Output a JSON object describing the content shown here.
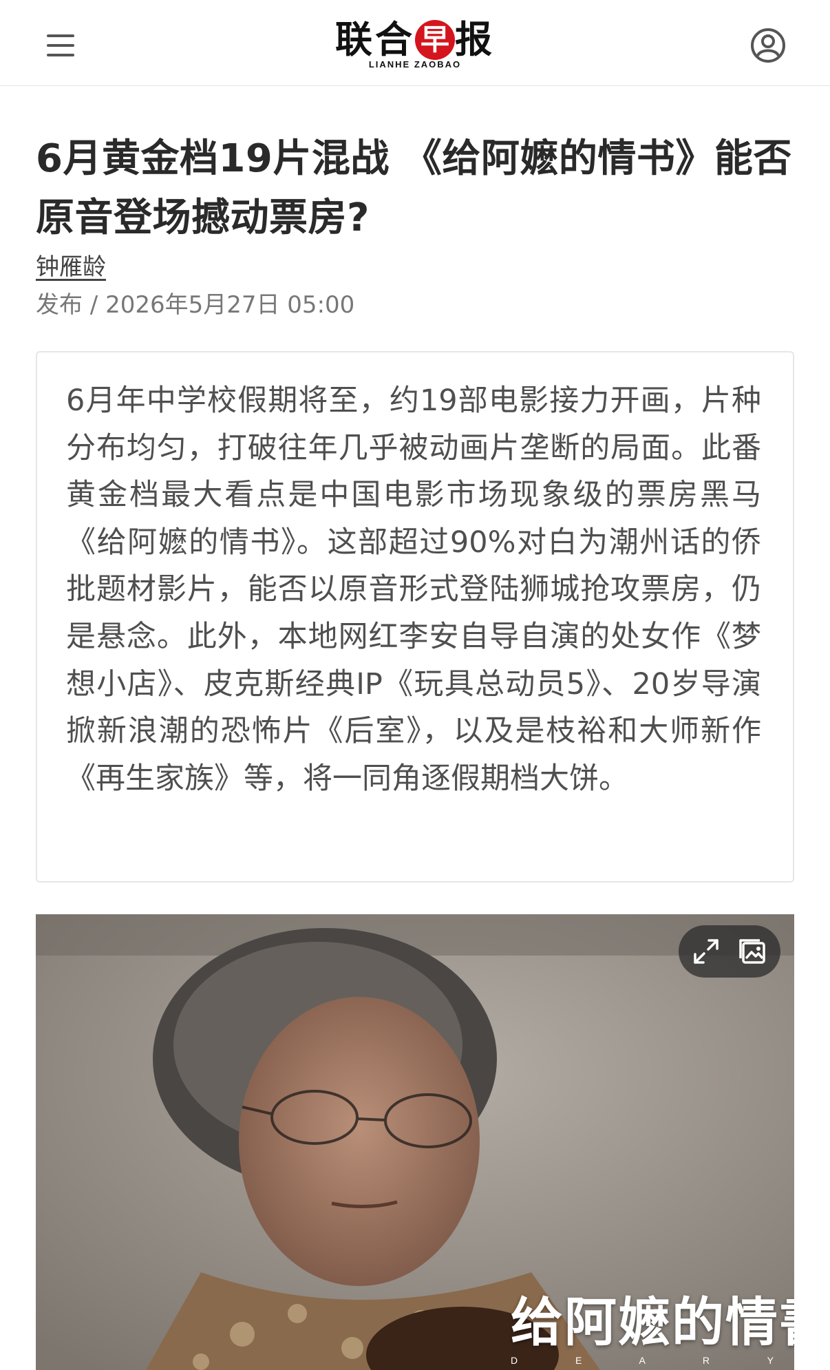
{
  "header": {
    "menu_icon": "hamburger-menu-icon",
    "logo_cn_before": "联合",
    "logo_cn_red": "早",
    "logo_cn_after": "报",
    "logo_en": "LIANHE ZAOBAO",
    "profile_icon": "user-account-icon"
  },
  "article": {
    "title": "6月黄金档19片混战 《给阿嬷的情书》能否原音登场撼动票房?",
    "author": "钟雁龄",
    "published": "发布 / 2026年5月27日 05:00",
    "summary": "6月年中学校假期将至，约19部电影接力开画，片种分布均匀，打破往年几乎被动画片垄断的局面。此番黄金档最大看点是中国电影市场现象级的票房黑马《给阿嬷的情书》。这部超过90%对白为潮州话的侨批题材影片，能否以原音形式登陆狮城抢攻票房，仍是悬念。此外，本地网红李安自导自演的处女作《梦想小店》、皮克斯经典IP《玩具总动员5》、20岁导演掀新浪潮的恐怖片《后室》，以及是枝裕和大师新作《再生家族》等，将一同角逐假期档大饼。"
  },
  "image": {
    "expand_icon": "expand-icon",
    "gallery_icon": "gallery-icon",
    "film_title": "给阿嬷的情書",
    "film_subtitle": "D E A R Y O U"
  },
  "colors": {
    "brand_red": "#d4151e",
    "title_text": "#2a2a2a",
    "meta_text": "#777777",
    "summary_border": "#e6e6e6"
  }
}
